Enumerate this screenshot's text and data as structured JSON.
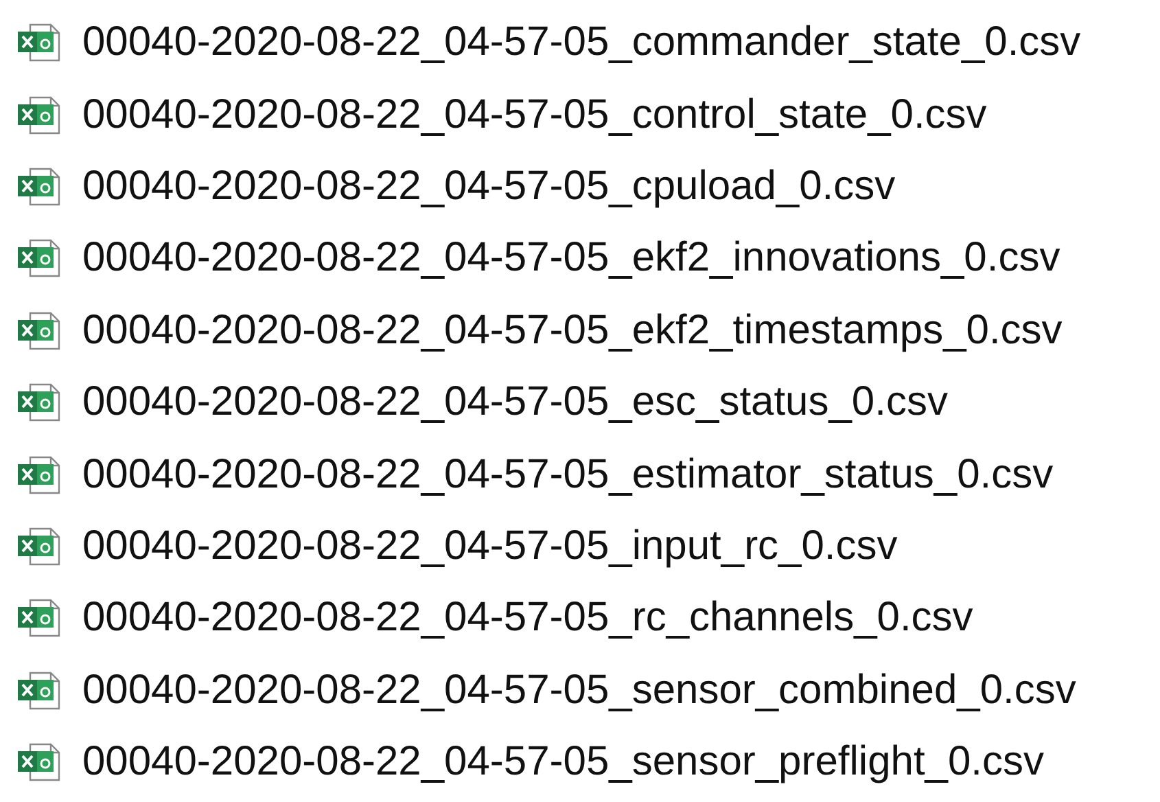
{
  "files": [
    {
      "name": "00040-2020-08-22_04-57-05_commander_state_0.csv"
    },
    {
      "name": "00040-2020-08-22_04-57-05_control_state_0.csv"
    },
    {
      "name": "00040-2020-08-22_04-57-05_cpuload_0.csv"
    },
    {
      "name": "00040-2020-08-22_04-57-05_ekf2_innovations_0.csv"
    },
    {
      "name": "00040-2020-08-22_04-57-05_ekf2_timestamps_0.csv"
    },
    {
      "name": "00040-2020-08-22_04-57-05_esc_status_0.csv"
    },
    {
      "name": "00040-2020-08-22_04-57-05_estimator_status_0.csv"
    },
    {
      "name": "00040-2020-08-22_04-57-05_input_rc_0.csv"
    },
    {
      "name": "00040-2020-08-22_04-57-05_rc_channels_0.csv"
    },
    {
      "name": "00040-2020-08-22_04-57-05_sensor_combined_0.csv"
    },
    {
      "name": "00040-2020-08-22_04-57-05_sensor_preflight_0.csv"
    }
  ]
}
